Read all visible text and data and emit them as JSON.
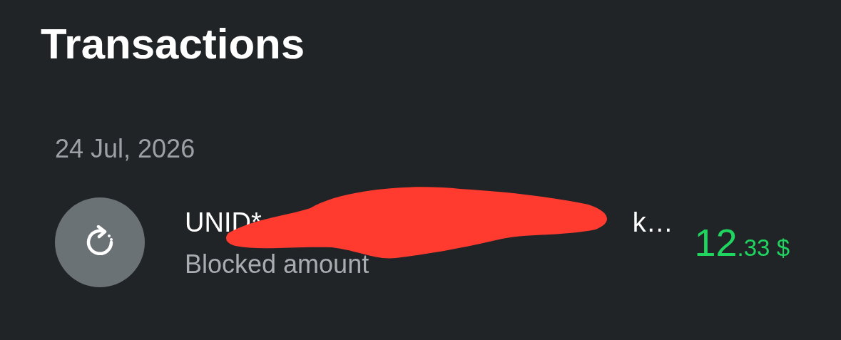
{
  "title": "Transactions",
  "groups": [
    {
      "date": "24 Jul, 2026",
      "transactions": [
        {
          "name_start": "UNID*",
          "name_end": "k…",
          "subtitle": "Blocked amount",
          "amount_whole": "12",
          "amount_rest": ".33 $",
          "redacted": true
        }
      ]
    }
  ]
}
